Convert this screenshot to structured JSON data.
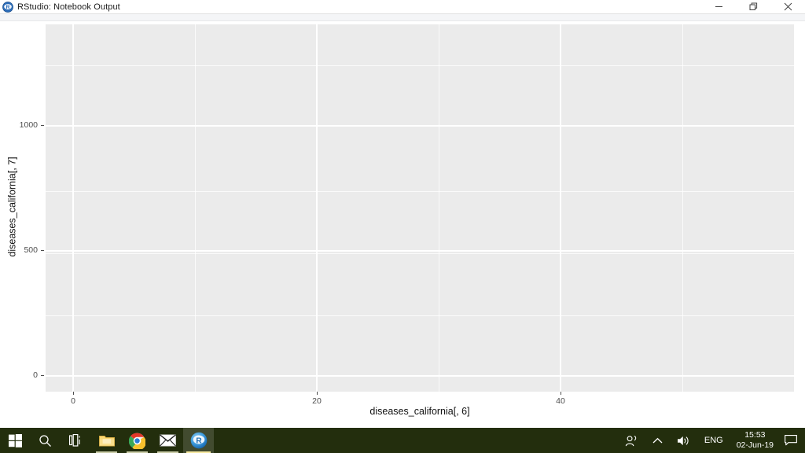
{
  "window": {
    "title": "RStudio: Notebook Output",
    "icon": "rstudio-logo-icon",
    "controls": {
      "minimize": "Minimize",
      "restore": "Restore",
      "close": "Close"
    }
  },
  "chart_data": {
    "type": "scatter",
    "title": "",
    "subtitle": "",
    "xlabel": "diseases_california[, 6]",
    "ylabel": "diseases_california[, 7]",
    "x": [],
    "y": [],
    "series": [],
    "xlim": [
      -4,
      57
    ],
    "ylim": [
      -100,
      1400
    ],
    "x_ticks": [
      0,
      20,
      40
    ],
    "x_tick_labels": [
      "0",
      "20",
      "40"
    ],
    "y_ticks": [
      0,
      500,
      1000
    ],
    "y_tick_labels": [
      "0",
      "500",
      "1000"
    ],
    "x_minor_ticks": [
      10,
      30,
      50
    ],
    "y_minor_ticks": [
      250,
      750,
      1250
    ],
    "grid": true,
    "grid_major_color": "#ffffff",
    "grid_minor_color": "#ffffff",
    "panel_background": "#ebebeb",
    "plot_background": "#ffffff",
    "legend": "none",
    "annotations": [],
    "note": "Empty ggplot2 panel - no data points rendered"
  },
  "taskbar": {
    "items": [
      {
        "name": "start-button",
        "label": "Start"
      },
      {
        "name": "search-button",
        "label": "Search"
      },
      {
        "name": "task-view-button",
        "label": "Task View"
      },
      {
        "name": "file-explorer-button",
        "label": "File Explorer"
      },
      {
        "name": "chrome-button",
        "label": "Google Chrome"
      },
      {
        "name": "mail-button",
        "label": "Mail"
      },
      {
        "name": "rstudio-button",
        "label": "RStudio"
      }
    ],
    "tray": {
      "people": "People",
      "show_hidden": "Show hidden icons",
      "volume": "Volume",
      "language": "ENG",
      "time": "15:53",
      "date": "02-Jun-19",
      "notifications": "Notifications"
    }
  }
}
